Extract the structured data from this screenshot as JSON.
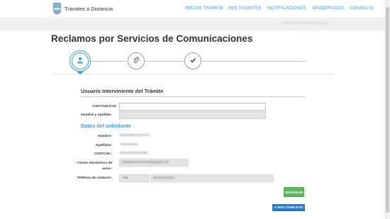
{
  "brand": {
    "name": "Trámites a Distancia",
    "logo_icon": "argentina-shield-icon"
  },
  "nav": {
    "items": [
      "INICIAR TRÁMITE",
      "MIS TRÁMITES",
      "NOTIFICACIONES",
      "APODERADOS",
      "CONSULTA"
    ]
  },
  "user_menu": {
    "label": "XXXXXXX XXXXXXX XXXXXXX"
  },
  "page": {
    "title": "Reclamos por Servicios de Comunicaciones"
  },
  "steps": [
    {
      "icon": "user-icon",
      "state": "active"
    },
    {
      "icon": "paperclip-icon",
      "state": "pending"
    },
    {
      "icon": "checkmark-icon",
      "state": "pending"
    }
  ],
  "form": {
    "section_title": "Usuario Interviniente del Trámite",
    "cuit_label": "CUIT/CUIL/CDI:",
    "cuit_value": "",
    "nombre_label": "Nombre y Apellido:",
    "nombre_value": "",
    "solicitante_title": "Datos del solicitante",
    "nombre_s_label": "Nombre:",
    "nombre_s_value": "EDUARXXXXXXXX",
    "apellidos_label": "Apellidos:",
    "apellidos_value": "ARXXXXXX",
    "cuit_s_label": "CUIT/CUIL:",
    "cuit_s_value": "20XXXXXXXX786",
    "email_label_1": "Correo electrónico de",
    "email_label_2": "aviso:",
    "email_value": "eduaxxxxxxxxxxxx@gmail.com",
    "phone_label": "Teléfono de contacto:",
    "phone_code": "+54",
    "phone_number": "3424XXXXXX"
  },
  "buttons": {
    "update": "UPDATEAR",
    "complete": "▾ VER COMPLETO"
  },
  "colors": {
    "accent": "#37a1d6",
    "update_green": "#5cb85c",
    "complete_blue": "#2a7ac0"
  }
}
